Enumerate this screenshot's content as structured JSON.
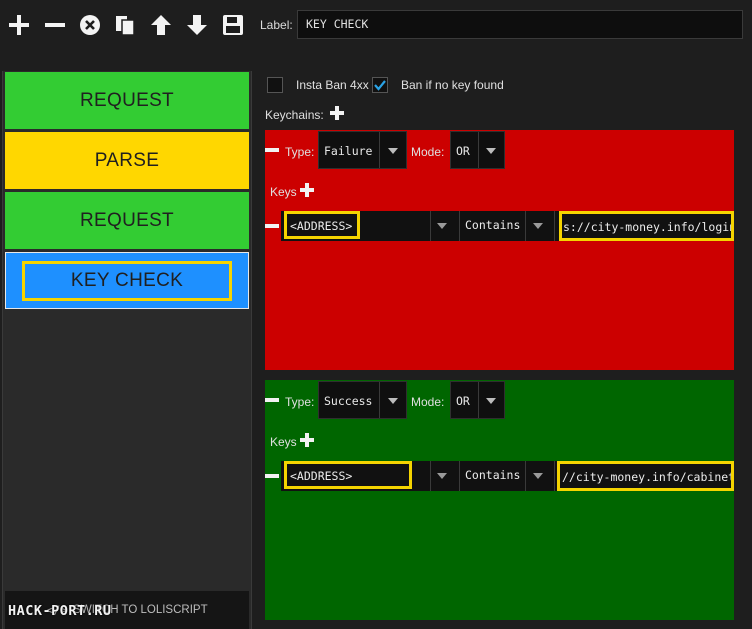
{
  "toolbar": {
    "icons": [
      "plus-icon",
      "minus-icon",
      "close-circle-icon",
      "copy-icon",
      "arrow-up-icon",
      "arrow-down-icon",
      "save-icon"
    ],
    "label_caption": "Label:",
    "label_value": "KEY CHECK"
  },
  "blocks": [
    {
      "label": "REQUEST",
      "color": "#33cc33"
    },
    {
      "label": "PARSE",
      "color": "#ffd700"
    },
    {
      "label": "REQUEST",
      "color": "#33cc33"
    },
    {
      "label": "KEY CHECK",
      "color": "#1e90ff",
      "selected": true
    }
  ],
  "switch_label": "SWITCH TO LOLISCRIPT",
  "watermark": "HACK-PORT.RU",
  "options": {
    "insta_ban_label": "Insta Ban 4xx",
    "insta_ban_checked": false,
    "ban_no_key_label": "Ban if no key found",
    "ban_no_key_checked": true
  },
  "keychains_label": "Keychains:",
  "keychains": [
    {
      "color": "#cc0000",
      "type_label": "Type:",
      "type_value": "Failure",
      "mode_label": "Mode:",
      "mode_value": "OR",
      "keys_label": "Keys",
      "key": {
        "variable": "<ADDRESS>",
        "condition": "Contains",
        "value": "s://city-money.info/login"
      }
    },
    {
      "color": "#006600",
      "type_label": "Type:",
      "type_value": "Success",
      "mode_label": "Mode:",
      "mode_value": "OR",
      "keys_label": "Keys",
      "key": {
        "variable": "<ADDRESS>",
        "condition": "Contains",
        "value": "//city-money.info/cabinet"
      }
    }
  ]
}
